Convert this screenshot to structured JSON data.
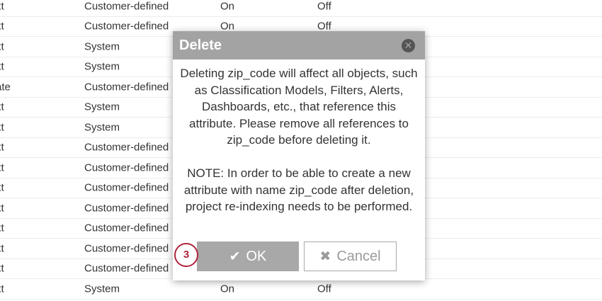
{
  "table": {
    "rows": [
      {
        "type": "xt",
        "source": "Customer-defined",
        "col_a": "On",
        "col_b": "Off"
      },
      {
        "type": "xt",
        "source": "Customer-defined",
        "col_a": "On",
        "col_b": "Off"
      },
      {
        "type": "xt",
        "source": "System",
        "col_a": "",
        "col_b": ""
      },
      {
        "type": "xt",
        "source": "System",
        "col_a": "",
        "col_b": ""
      },
      {
        "type": "ate",
        "source": "Customer-defined",
        "col_a": "",
        "col_b": ""
      },
      {
        "type": "xt",
        "source": "System",
        "col_a": "",
        "col_b": ""
      },
      {
        "type": "xt",
        "source": "System",
        "col_a": "",
        "col_b": ""
      },
      {
        "type": "xt",
        "source": "Customer-defined",
        "col_a": "",
        "col_b": ""
      },
      {
        "type": "xt",
        "source": "Customer-defined",
        "col_a": "",
        "col_b": ""
      },
      {
        "type": "xt",
        "source": "Customer-defined",
        "col_a": "",
        "col_b": ""
      },
      {
        "type": "xt",
        "source": "Customer-defined",
        "col_a": "",
        "col_b": ""
      },
      {
        "type": "xt",
        "source": "Customer-defined",
        "col_a": "",
        "col_b": ""
      },
      {
        "type": "xt",
        "source": "Customer-defined",
        "col_a": "",
        "col_b": ""
      },
      {
        "type": "xt",
        "source": "Customer-defined",
        "col_a": "",
        "col_b": ""
      },
      {
        "type": "xt",
        "source": "System",
        "col_a": "On",
        "col_b": "Off"
      }
    ]
  },
  "dialog": {
    "title": "Delete",
    "close_icon": "close-icon",
    "message": "Deleting zip_code will affect all objects, such as Classification Models, Filters, Alerts, Dashboards, etc., that reference this attribute. Please remove all references to zip_code before deleting it.",
    "note": "NOTE: In order to be able to create a new attribute with name zip_code after deletion, project re-indexing needs to be performed.",
    "ok_icon": "✔",
    "ok_label": "OK",
    "cancel_icon": "✖",
    "cancel_label": "Cancel"
  },
  "annotation": {
    "step_number": "3",
    "color": "#b0253f"
  },
  "colors": {
    "header_bg": "#a3a3a3",
    "ok_bg": "#a8a8a8",
    "text": "#333333"
  }
}
